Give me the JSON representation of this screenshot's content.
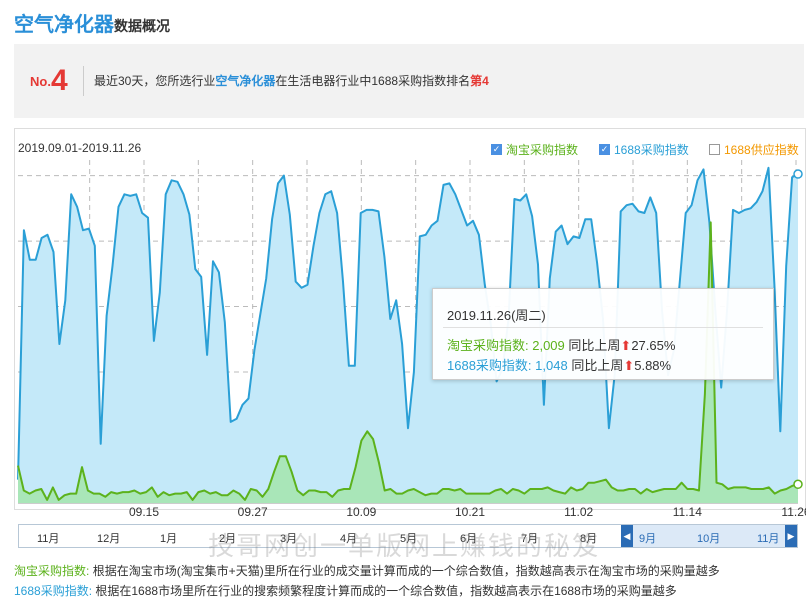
{
  "header": {
    "title": "空气净化器",
    "subtitle": "数据概况"
  },
  "rank": {
    "no": "No.",
    "number": "4",
    "text_pre": "最近30天，您所选行业",
    "industry": "空气净化器",
    "text_mid": "在生活电器行业中1688采购指数排名",
    "rank_label": "第4"
  },
  "chart_top": {
    "date_range": "2019.09.01-2019.11.26",
    "legend": [
      {
        "label": "淘宝采购指数",
        "checked": true,
        "color": "#5cb21c"
      },
      {
        "label": "1688采购指数",
        "checked": true,
        "color": "#2a9fd6"
      },
      {
        "label": "1688供应指数",
        "checked": false,
        "color": "#f39800"
      }
    ]
  },
  "chart_data": {
    "type": "area",
    "x_ticks": [
      "09.15",
      "09.27",
      "10.09",
      "10.21",
      "11.02",
      "11.14",
      "11.26"
    ],
    "ylim": [
      0,
      2200
    ],
    "grid": true,
    "legend_position": "top-right",
    "series": [
      {
        "name": "1688采购指数",
        "color": "#2a9fd6",
        "fill": "#c4e9f9",
        "values": [
          150,
          1750,
          1560,
          1560,
          1700,
          1720,
          1610,
          1020,
          1300,
          1980,
          1900,
          1750,
          1760,
          1650,
          380,
          1200,
          1520,
          1900,
          1980,
          1970,
          1980,
          1860,
          1830,
          1040,
          1350,
          1980,
          2070,
          2060,
          1980,
          1850,
          1500,
          1450,
          950,
          1550,
          1480,
          1160,
          520,
          540,
          630,
          670,
          980,
          1210,
          1440,
          1820,
          2050,
          2100,
          1850,
          1420,
          1380,
          1400,
          1650,
          1860,
          1980,
          2000,
          1860,
          1420,
          880,
          880,
          1860,
          1880,
          1880,
          1870,
          1580,
          1180,
          1300,
          1020,
          480,
          840,
          1710,
          1720,
          1780,
          1810,
          2040,
          2050,
          1980,
          1880,
          1780,
          1810,
          1720,
          1400,
          1150,
          780,
          860,
          1180,
          1950,
          1940,
          1980,
          1840,
          1530,
          630,
          1440,
          1740,
          1780,
          1660,
          1710,
          1700,
          1820,
          1820,
          1540,
          1180,
          480,
          830,
          1870,
          1910,
          1920,
          1870,
          1860,
          1960,
          1860,
          1230,
          820,
          980,
          1420,
          1860,
          1910,
          2070,
          2140,
          1800,
          1240,
          740,
          1240,
          1880,
          1860,
          1880,
          1890,
          1930,
          2000,
          2150,
          1400,
          460,
          1520,
          2090,
          2110
        ]
      },
      {
        "name": "淘宝采购指数",
        "color": "#5cb21c",
        "fill": "#a8e6b4",
        "values": [
          240,
          80,
          60,
          80,
          90,
          20,
          100,
          20,
          50,
          60,
          60,
          230,
          80,
          60,
          60,
          40,
          70,
          60,
          70,
          70,
          80,
          60,
          70,
          100,
          40,
          70,
          50,
          60,
          60,
          70,
          20,
          70,
          80,
          60,
          70,
          50,
          50,
          80,
          60,
          20,
          90,
          80,
          40,
          90,
          200,
          300,
          300,
          200,
          80,
          50,
          80,
          80,
          70,
          70,
          40,
          80,
          90,
          90,
          230,
          400,
          460,
          410,
          260,
          80,
          90,
          60,
          60,
          80,
          90,
          70,
          50,
          60,
          60,
          90,
          90,
          80,
          90,
          60,
          60,
          60,
          60,
          60,
          80,
          90,
          60,
          90,
          80,
          60,
          90,
          90,
          90,
          100,
          80,
          70,
          60,
          100,
          80,
          90,
          130,
          130,
          140,
          150,
          100,
          80,
          80,
          90,
          90,
          60,
          90,
          70,
          80,
          90,
          90,
          90,
          130,
          90,
          90,
          80,
          700,
          1800,
          130,
          120,
          90,
          100,
          100,
          100,
          90,
          90,
          90,
          100,
          60,
          80,
          90,
          110,
          120
        ]
      }
    ]
  },
  "tooltip": {
    "date": "2019.11.26(周二)",
    "rows": [
      {
        "label": "淘宝采购指数: 2,009",
        "compare": "同比上周",
        "change": "27.65%",
        "color": "#5cb21c"
      },
      {
        "label": "1688采购指数: 1,048",
        "compare": "同比上周",
        "change": "5.88%",
        "color": "#2a9fd6"
      }
    ]
  },
  "navigator": {
    "months": [
      "11月",
      "12月",
      "1月",
      "2月",
      "3月",
      "4月",
      "5月",
      "6月",
      "7月",
      "8月",
      "9月",
      "10月",
      "11月"
    ],
    "left_arrow": "◀",
    "right_arrow": "▶"
  },
  "descriptions": [
    {
      "label": "淘宝采购指数:",
      "text": "根据在淘宝市场(淘宝集市+天猫)里所在行业的成交量计算而成的一个综合数值，指数越高表示在淘宝市场的采购量越多"
    },
    {
      "label": "1688采购指数:",
      "text": "根据在1688市场里所在行业的搜索频繁程度计算而成的一个综合数值，指数越高表示在1688市场的采购量越多"
    }
  ],
  "watermark": "技哥网创一单版网上赚钱的秘笈"
}
